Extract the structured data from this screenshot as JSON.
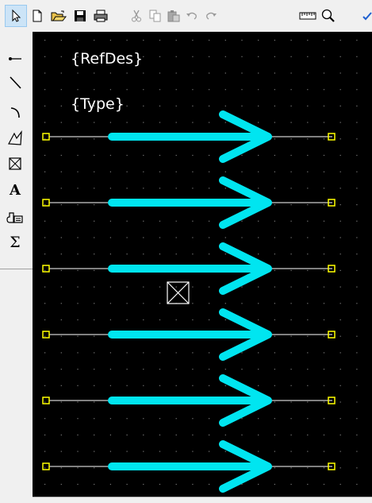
{
  "toolbar": {
    "buttons": [
      {
        "icon": "select-arrow-icon",
        "active": true
      },
      {
        "icon": "new-document-icon"
      },
      {
        "icon": "open-folder-icon"
      },
      {
        "icon": "save-icon"
      },
      {
        "icon": "print-icon"
      },
      {
        "icon": "cut-icon",
        "disabled": true
      },
      {
        "icon": "copy-icon",
        "disabled": true
      },
      {
        "icon": "paste-icon",
        "disabled": true
      },
      {
        "icon": "undo-icon",
        "disabled": true
      },
      {
        "icon": "redo-icon",
        "disabled": true
      },
      {
        "icon": "measure-ruler-icon"
      },
      {
        "icon": "zoom-icon"
      },
      {
        "icon": "check-icon"
      }
    ]
  },
  "palette": {
    "tools": [
      "pin-tool-icon",
      "line-tool-icon",
      "arc-tool-icon",
      "polygon-tool-icon",
      "box-tool-icon",
      "text-tool-icon",
      "label-tool-icon",
      "sum-tool-icon"
    ],
    "text_tool_label": "A",
    "sum_tool_label": "Σ"
  },
  "canvas": {
    "refdes_label": "{RefDes}",
    "type_label": "{Type}",
    "pin_count": 6,
    "colors": {
      "background": "#000000",
      "grid_dot": "#7a7a7a",
      "pin_line": "#ffffff",
      "arrow": "#00e5f0",
      "pin_end": "#ffff00",
      "origin_marker": "#ffffff"
    }
  }
}
